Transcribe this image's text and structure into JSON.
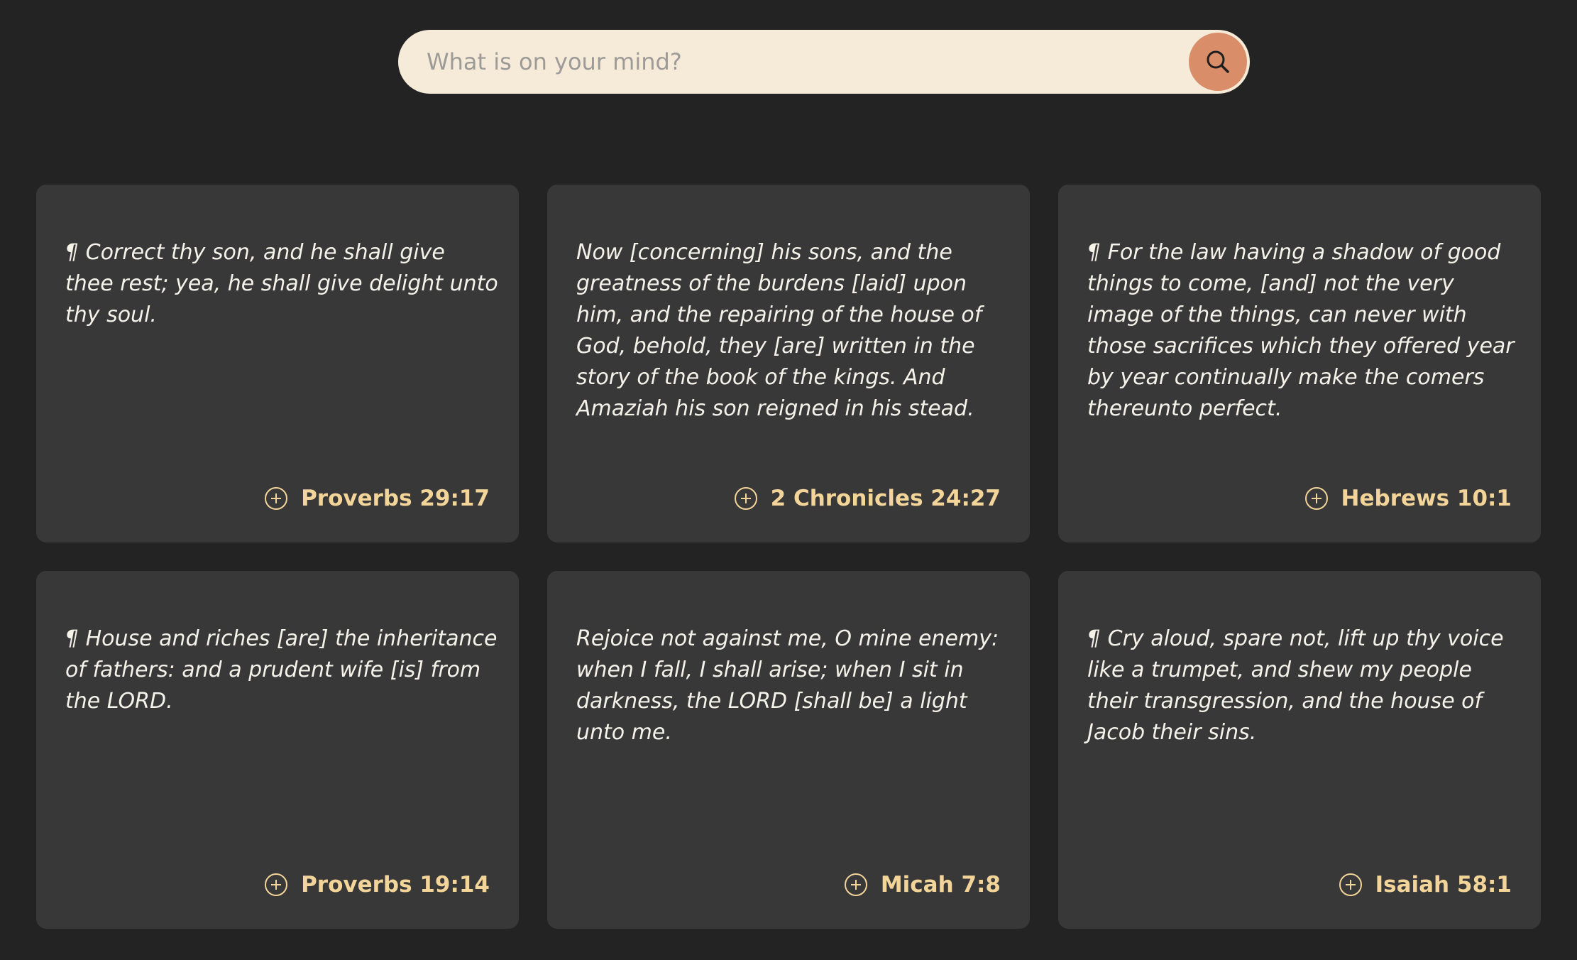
{
  "search": {
    "placeholder": "What is on your mind?",
    "value": "",
    "icon": "search-icon"
  },
  "colors": {
    "background": "#232323",
    "card": "#383838",
    "search_bg": "#f6ead8",
    "search_button": "#d98d68",
    "accent": "#f3d59a",
    "verse_text": "#f5f2ea"
  },
  "cards": [
    {
      "text": "¶ Correct thy son, and he shall give thee rest; yea, he shall give delight unto thy soul.",
      "reference": "Proverbs 29:17",
      "icon": "plus-circle-icon"
    },
    {
      "text": "Now [concerning] his sons, and the greatness of the burdens [laid] upon him, and the repairing of the house of God, behold, they [are] written in the story of the book of the kings. And Amaziah his son reigned in his stead.",
      "reference": "2 Chronicles 24:27",
      "icon": "plus-circle-icon"
    },
    {
      "text": "¶ For the law having a shadow of good things to come, [and] not the very image of the things, can never with those sacrifices which they offered year by year continually make the comers thereunto perfect.",
      "reference": "Hebrews 10:1",
      "icon": "plus-circle-icon"
    },
    {
      "text": "¶ House and riches [are] the inheritance of fathers: and a prudent wife [is] from the LORD.",
      "reference": "Proverbs 19:14",
      "icon": "plus-circle-icon"
    },
    {
      "text": "Rejoice not against me, O mine enemy: when I fall, I shall arise; when I sit in darkness, the LORD [shall be] a light unto me.",
      "reference": "Micah 7:8",
      "icon": "plus-circle-icon"
    },
    {
      "text": "¶ Cry aloud, spare not, lift up thy voice like a trumpet, and shew my people their transgression, and the house of Jacob their sins.",
      "reference": "Isaiah 58:1",
      "icon": "plus-circle-icon"
    }
  ]
}
